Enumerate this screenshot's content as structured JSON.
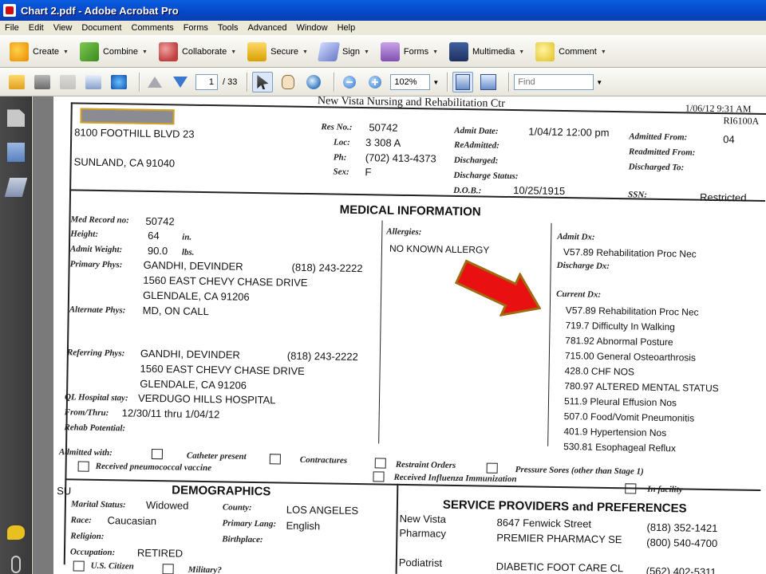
{
  "window": {
    "title": "Chart 2.pdf - Adobe Acrobat Pro"
  },
  "menubar": [
    "File",
    "Edit",
    "View",
    "Document",
    "Comments",
    "Forms",
    "Tools",
    "Advanced",
    "Window",
    "Help"
  ],
  "toolbar": {
    "create": "Create",
    "combine": "Combine",
    "collaborate": "Collaborate",
    "secure": "Secure",
    "sign": "Sign",
    "forms": "Forms",
    "multimedia": "Multimedia",
    "comment": "Comment"
  },
  "nav": {
    "page_current": "1",
    "page_total": "/ 33",
    "zoom": "102%",
    "find_placeholder": "Find"
  },
  "doc": {
    "header": {
      "facility": "New Vista Nursing and Rehabilitation Ctr",
      "date_time": "1/06/12  9:31 AM",
      "form_id": "RI6100A"
    },
    "resident": {
      "address1": "8100 FOOTHILL BLVD 23",
      "address2": "SUNLAND, CA   91040",
      "res_no_label": "Res No.:",
      "res_no": "50742",
      "loc_label": "Loc:",
      "loc": "3 308   A",
      "ph_label": "Ph:",
      "ph": "(702) 413-4373",
      "sex_label": "Sex:",
      "sex": "F",
      "admit_date_label": "Admit Date:",
      "admit_date": "1/04/12  12:00 pm",
      "readmitted_label": "ReAdmitted:",
      "discharged_label": "Discharged:",
      "discharge_status_label": "Discharge Status:",
      "dob_label": "D.O.B.:",
      "dob": "10/25/1915",
      "admitted_from_label": "Admitted From:",
      "admitted_from": "04",
      "readmitted_from_label": "Readmitted From:",
      "discharged_to_label": "Discharged To:",
      "ssn_label": "SSN:",
      "ssn": "Restricted"
    },
    "medical": {
      "title": "MEDICAL INFORMATION",
      "med_record_label": "Med Record no:",
      "med_record": "50742",
      "height_label": "Height:",
      "height": "64",
      "height_unit": "in.",
      "weight_label": "Admit Weight:",
      "weight": "90.0",
      "weight_unit": "lbs.",
      "primary_label": "Primary Phys:",
      "primary_name": "GANDHI, DEVINDER",
      "primary_phone": "(818) 243-2222",
      "primary_addr1": "1560 EAST CHEVY CHASE DRIVE",
      "primary_addr2": "GLENDALE, CA 91206",
      "alternate_label": "Alternate Phys:",
      "alternate": "MD, ON CALL",
      "referring_label": "Referring Phys:",
      "referring_name": "GANDHI, DEVINDER",
      "referring_phone": "(818) 243-2222",
      "referring_addr1": "1560 EAST CHEVY CHASE DRIVE",
      "referring_addr2": "GLENDALE, CA 91206",
      "hospital_label": "QL Hospital stay:",
      "hospital": "VERDUGO HILLS HOSPITAL",
      "fromthru_label": "From/Thru:",
      "fromthru": "12/30/11  thru  1/04/12",
      "rehab_label": "Rehab Potential:",
      "allergies_label": "Allergies:",
      "allergies": "NO KNOWN ALLERGY",
      "admit_dx_label": "Admit Dx:",
      "admit_dx": "V57.89 Rehabilitation Proc Nec",
      "discharge_dx_label": "Discharge Dx:",
      "current_dx_label": "Current Dx:",
      "current_dx": [
        "V57.89 Rehabilitation Proc Nec",
        "719.7 Difficulty In Walking",
        "781.92 Abnormal Posture",
        "715.00 General Osteoarthrosis",
        "428.0 CHF NOS",
        "780.97 ALTERED MENTAL STATUS",
        "511.9 Pleural Effusion Nos",
        "507.0 Food/Vomit Pneumonitis",
        "401.9 Hypertension Nos",
        "530.81 Esophageal Reflux"
      ]
    },
    "admitted_with": {
      "label": "Admitted with:",
      "catheter": "Catheter present",
      "contractures": "Contractures",
      "restraint": "Restraint Orders",
      "pressure": "Pressure Sores (other than Stage 1)",
      "pneumo": "Received pneumococcal vaccine",
      "influenza": "Received Influenza Immunization",
      "in_facility": "In facility"
    },
    "demographics": {
      "title": "DEMOGRAPHICS",
      "su": "SU",
      "marital_label": "Marital Status:",
      "marital": "Widowed",
      "race_label": "Race:",
      "race": "Caucasian",
      "religion_label": "Religion:",
      "occupation_label": "Occupation:",
      "occupation": "RETIRED",
      "county_label": "County:",
      "county": "LOS ANGELES",
      "language_label": "Primary Lang:",
      "language": "English",
      "birthplace_label": "Birthplace:",
      "citizen_label": "U.S. Citizen",
      "military_label": "Military?"
    },
    "service": {
      "title": "SERVICE PROVIDERS and PREFERENCES",
      "pharmacy_label1": "New Vista",
      "pharmacy_label2": "Pharmacy",
      "pharmacy_addr": "8647 Fenwick Street",
      "pharmacy_phone": "(818) 352-1421",
      "pharmacy_name": "PREMIER PHARMACY SE",
      "pharmacy_phone2": "(800) 540-4700",
      "podiatrist_label": "Podiatrist",
      "podiatrist_name": "DIABETIC FOOT CARE CL",
      "podiatrist_phone": "(562) 402-5311"
    }
  },
  "colors": {
    "titlebar": "#0a5ee0",
    "arrow": "#e81010",
    "arrow_outline": "#a06a10"
  }
}
